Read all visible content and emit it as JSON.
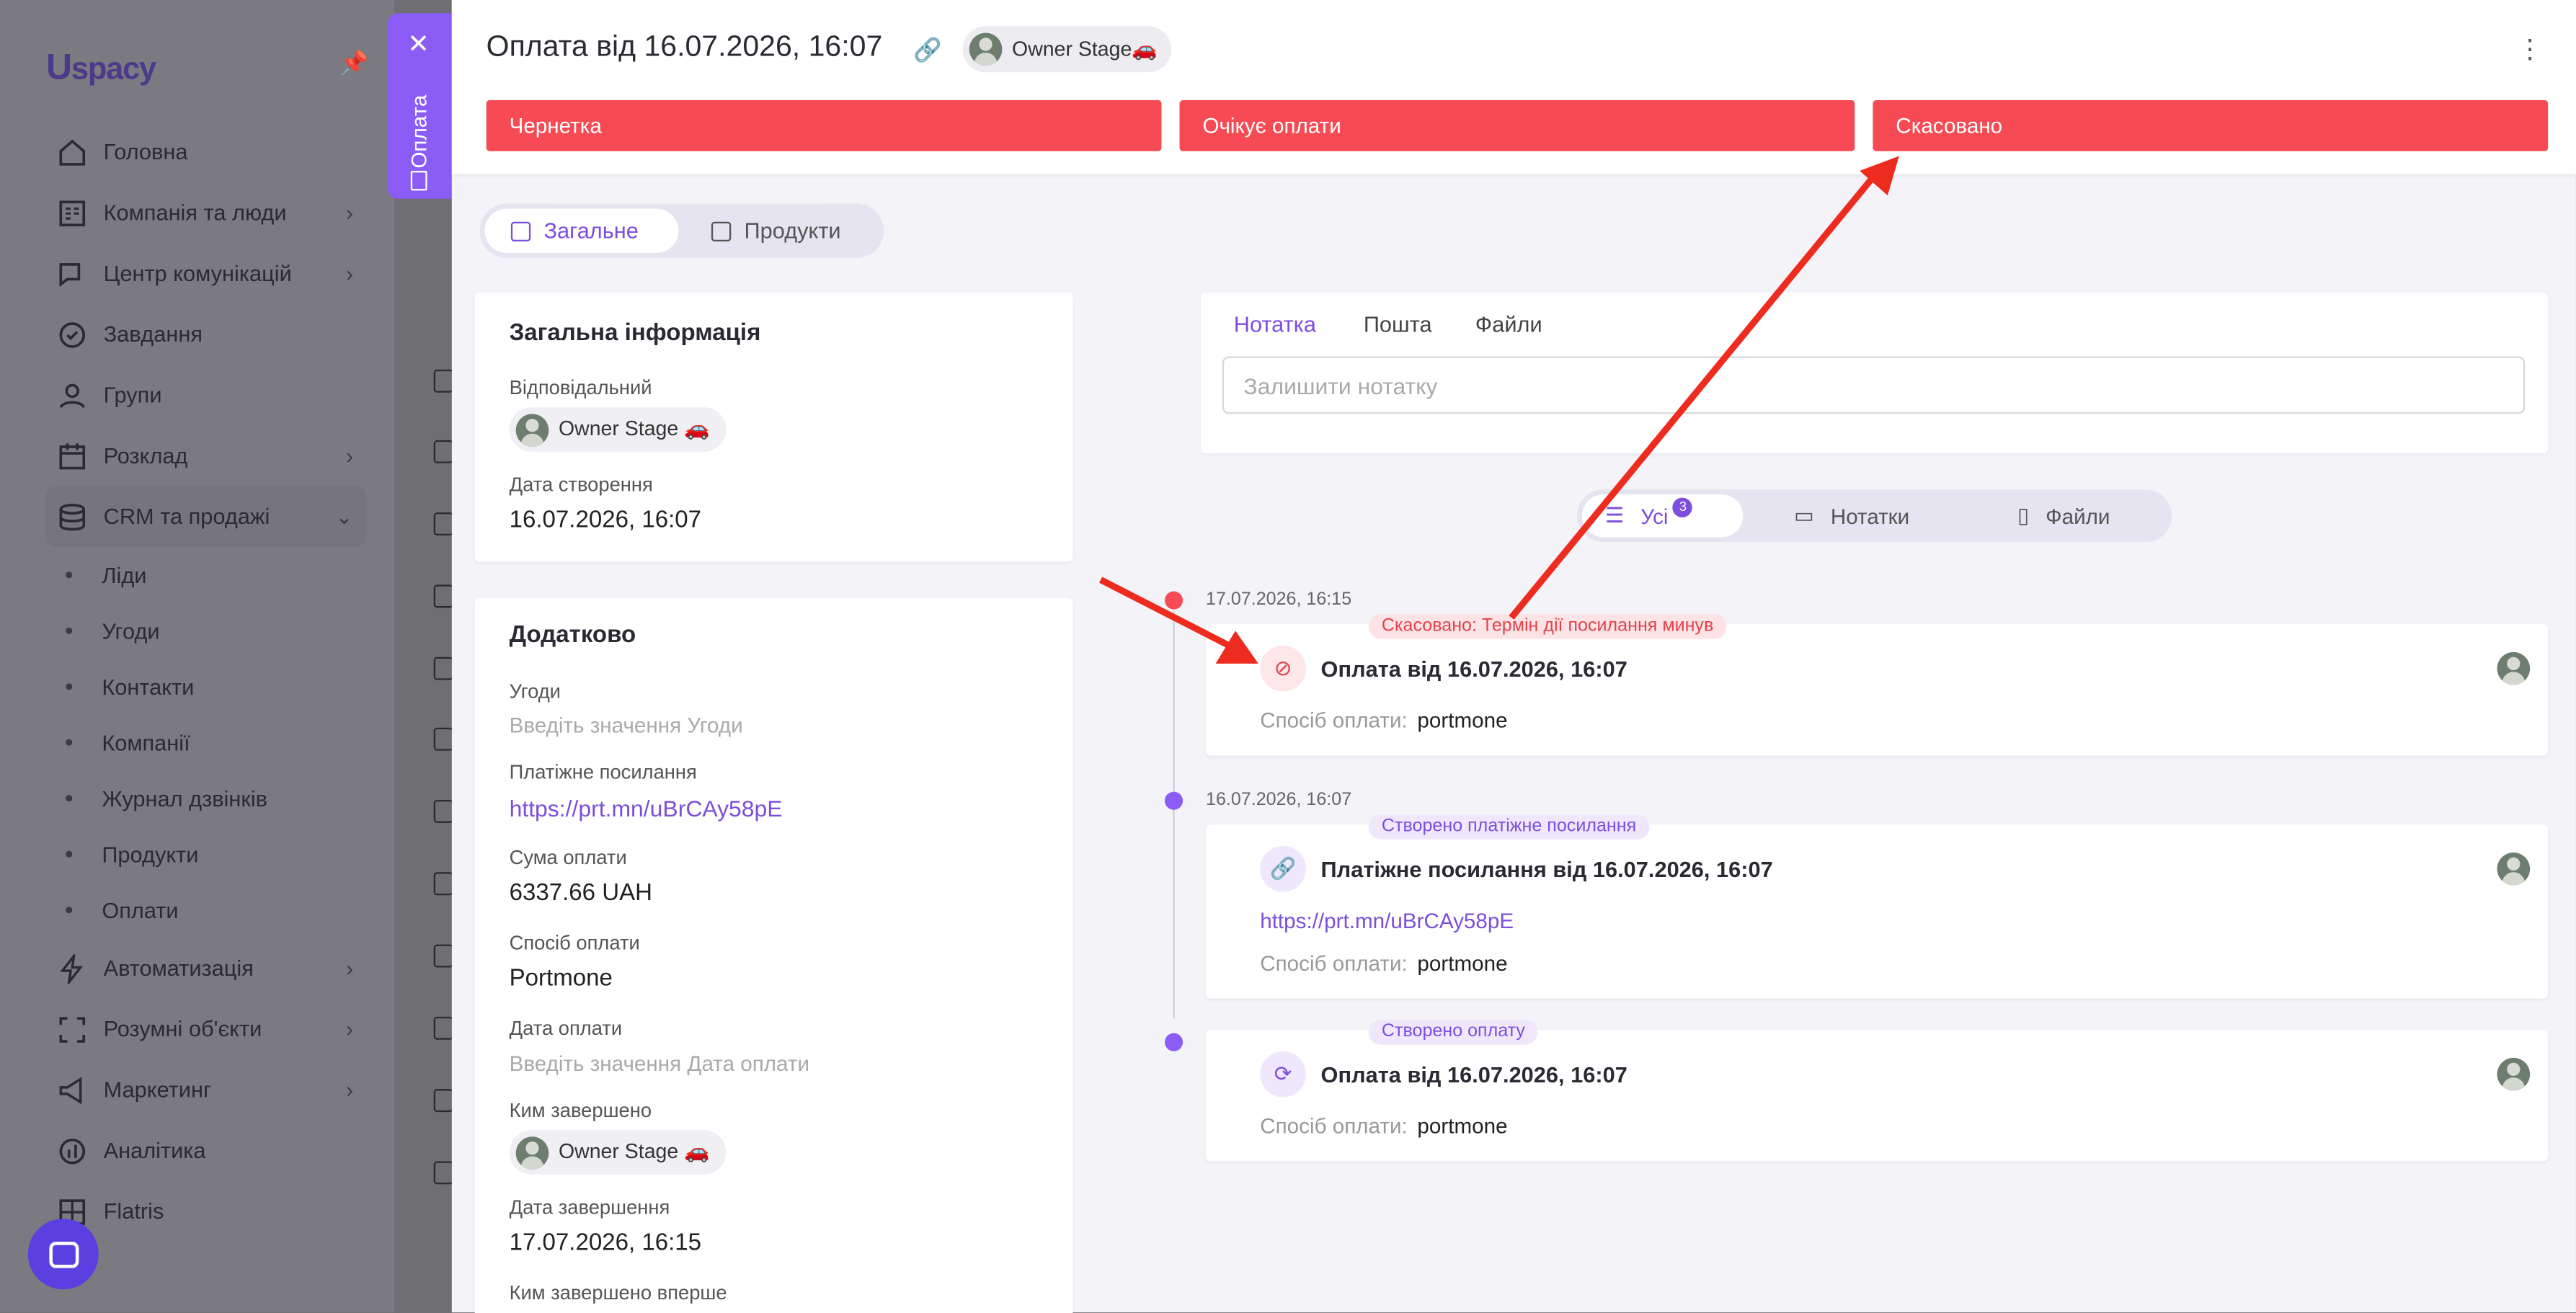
{
  "sidebar": {
    "logo_u": "U",
    "logo_text": "spacy",
    "nav": [
      {
        "label": "Головна",
        "icon": "home-icon",
        "chevron": false
      },
      {
        "label": "Компанія та люди",
        "icon": "company-icon",
        "chevron": true
      },
      {
        "label": "Центр комунікацій",
        "icon": "chat-edit-icon",
        "chevron": true
      },
      {
        "label": "Завдання",
        "icon": "check-circle-icon",
        "chevron": false
      },
      {
        "label": "Групи",
        "icon": "users-icon",
        "chevron": false
      },
      {
        "label": "Розклад",
        "icon": "calendar-icon",
        "chevron": true
      },
      {
        "label": "CRM та продажі",
        "icon": "database-icon",
        "chevron": true
      }
    ],
    "crm_sub": [
      "Ліди",
      "Угоди",
      "Контакти",
      "Компанії",
      "Журнал дзвінків",
      "Продукти",
      "Оплати"
    ],
    "nav_bottom": [
      {
        "label": "Автоматизація",
        "icon": "bolt-icon",
        "chevron": true
      },
      {
        "label": "Розумні об'єкти",
        "icon": "scan-icon",
        "chevron": true
      },
      {
        "label": "Маркетинг",
        "icon": "megaphone-icon",
        "chevron": true
      },
      {
        "label": "Аналітика",
        "icon": "chart-icon",
        "chevron": false
      },
      {
        "label": "Flatris",
        "icon": "grid-icon",
        "chevron": false
      }
    ]
  },
  "side_tab": {
    "label": "Оплата"
  },
  "header": {
    "title": "Оплата від 16.07.2026, 16:07",
    "owner": "Owner Stage🚗"
  },
  "stages": [
    "Чернетка",
    "Очікує оплати",
    "Скасовано"
  ],
  "tabs": [
    "Загальне",
    "Продукти"
  ],
  "general": {
    "title": "Загальна інформація",
    "responsible_label": "Відповідальний",
    "responsible": "Owner Stage 🚗",
    "created_label": "Дата створення",
    "created": "16.07.2026, 16:07"
  },
  "extra": {
    "title": "Додатково",
    "deals_label": "Угоди",
    "deals_placeholder": "Введіть значення Угоди",
    "pay_link_label": "Платіжне посилання",
    "pay_link": "https://prt.mn/uBrCAy58pE",
    "amount_label": "Сума оплати",
    "amount": "6337.66 UAH",
    "method_label": "Спосіб оплати",
    "method": "Portmone",
    "pay_date_label": "Дата оплати",
    "pay_date_placeholder": "Введіть значення Дата оплати",
    "completed_by_label": "Ким завершено",
    "completed_by": "Owner Stage 🚗",
    "completed_date_label": "Дата завершення",
    "completed_date": "17.07.2026, 16:15",
    "first_completed_label": "Ким завершено вперше"
  },
  "note_tabs": [
    "Нотатка",
    "Пошта",
    "Файли"
  ],
  "note_placeholder": "Залишити нотатку",
  "filters": {
    "all": "Усі",
    "all_count": "3",
    "notes": "Нотатки",
    "files": "Файли"
  },
  "timeline": [
    {
      "date": "17.07.2026, 16:15",
      "tag": "Скасовано: Термін дії посилання минув",
      "title": "Оплата від 16.07.2026, 16:07",
      "method_label": "Спосіб оплати:",
      "method": "portmone"
    },
    {
      "date": "16.07.2026, 16:07",
      "tag": "Створено платіжне посилання",
      "title": "Платіжне посилання від 16.07.2026, 16:07",
      "link": "https://prt.mn/uBrCAy58pE",
      "method_label": "Спосіб оплати:",
      "method": "portmone"
    },
    {
      "tag": "Створено оплату",
      "title": "Оплата від 16.07.2026, 16:07",
      "method_label": "Спосіб оплати:",
      "method": "portmone"
    }
  ],
  "colors": {
    "accent": "#7c4dde",
    "stage": "#f64b54",
    "arrow": "#ee2b1f"
  }
}
